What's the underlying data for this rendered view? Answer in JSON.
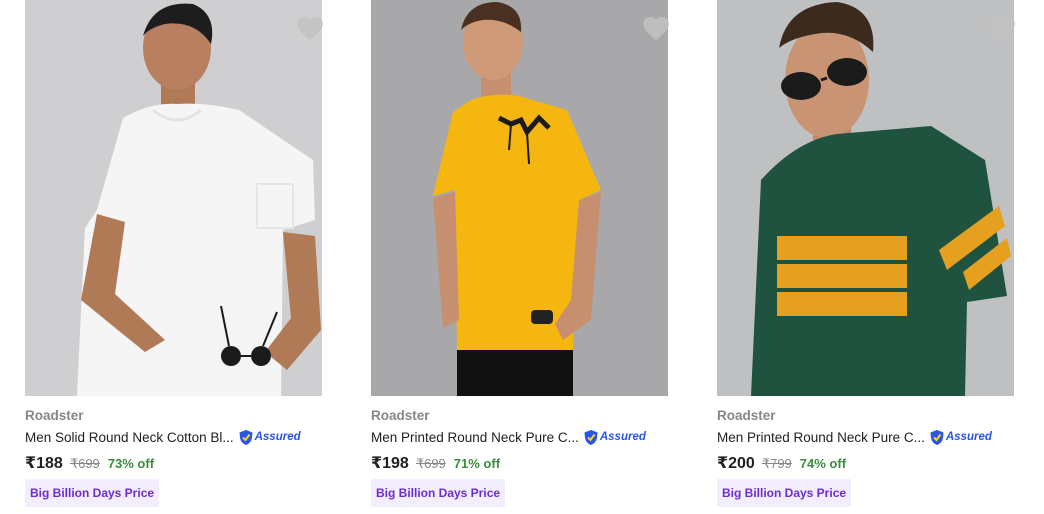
{
  "products": [
    {
      "brand": "Roadster",
      "title": "Men Solid Round Neck Cotton Bl...",
      "assured": "Assured",
      "price": "₹188",
      "mrp": "₹699",
      "discount": "73% off",
      "tag": "Big Billion Days Price",
      "shirt_color": "#f5f5f5",
      "bg_color": "#cfcfd1"
    },
    {
      "brand": "Roadster",
      "title": "Men Printed Round Neck Pure C...",
      "assured": "Assured",
      "price": "₹198",
      "mrp": "₹699",
      "discount": "71% off",
      "tag": "Big Billion Days Price",
      "shirt_color": "#f5b60f",
      "bg_color": "#a8a8aa"
    },
    {
      "brand": "Roadster",
      "title": "Men Printed Round Neck Pure C...",
      "assured": "Assured",
      "price": "₹200",
      "mrp": "₹799",
      "discount": "74% off",
      "tag": "Big Billion Days Price",
      "shirt_color": "#1f5340",
      "bg_color": "#bfc0c2"
    }
  ],
  "colors": {
    "assured_blue": "#2a55e5",
    "discount_green": "#388e3c",
    "tag_purple": "#6f2bd3",
    "tag_bg": "#f3eefe",
    "heart_gray": "#c2c2c2",
    "print_orange": "#e5a020"
  },
  "icons": {
    "wishlist": "heart-icon",
    "assured": "assured-shield-icon"
  }
}
